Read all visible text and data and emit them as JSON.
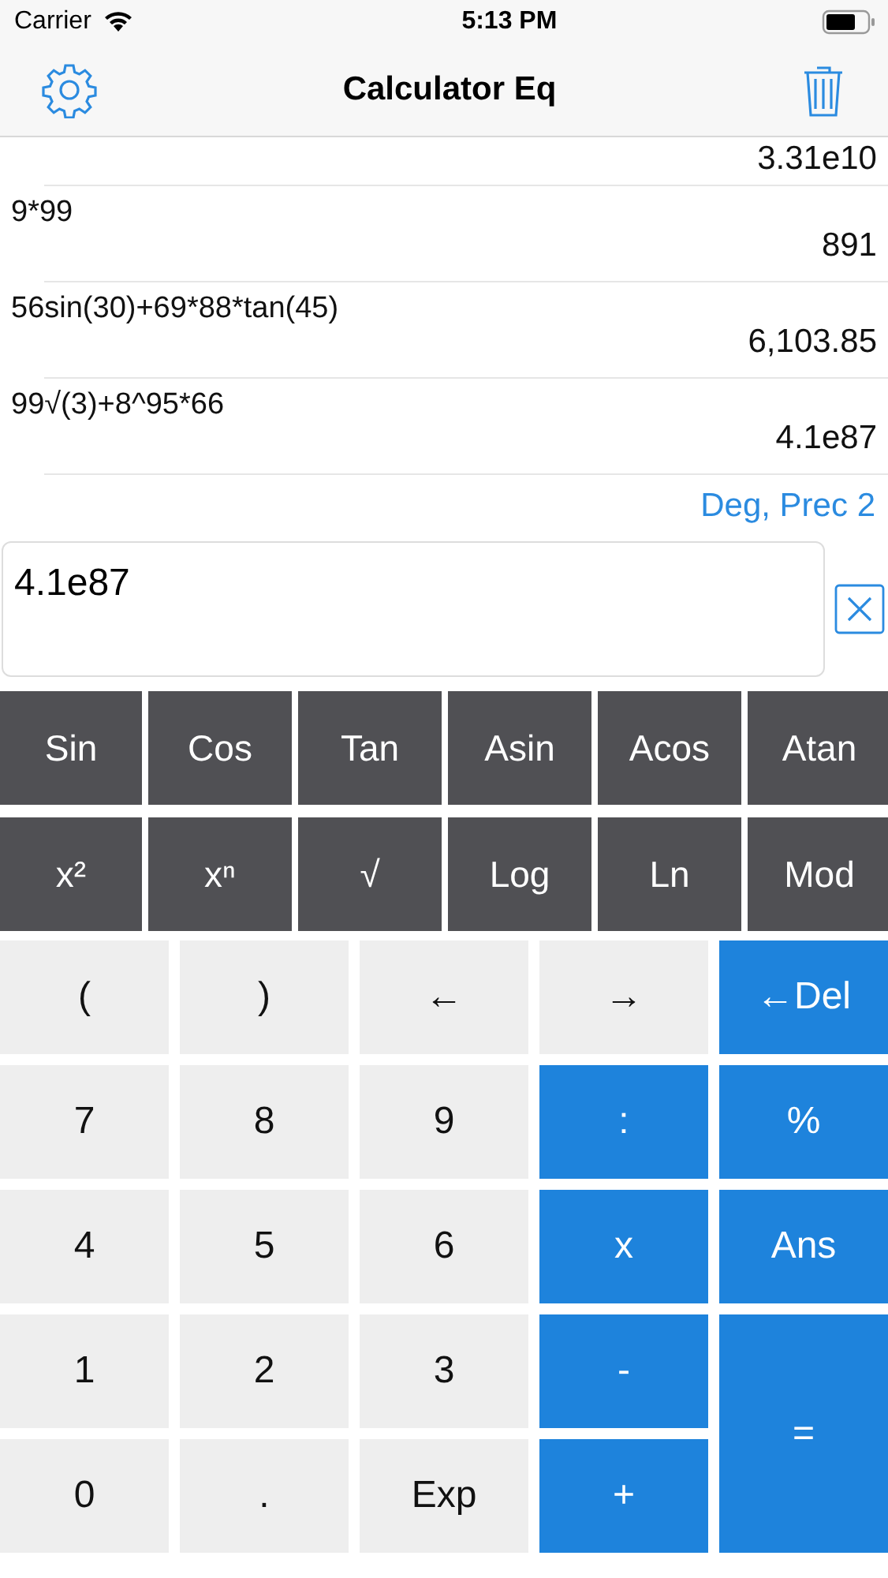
{
  "status_bar": {
    "carrier": "Carrier",
    "time": "5:13 PM"
  },
  "nav": {
    "title": "Calculator Eq"
  },
  "history": [
    {
      "result": "3.31e10"
    },
    {
      "expression": "9*99",
      "result": "891"
    },
    {
      "expression": "56sin(30)+69*88*tan(45)",
      "result": "6,103.85"
    },
    {
      "expression": "99√(3)+8^95*66",
      "result": "4.1e87"
    }
  ],
  "mode": "Deg, Prec 2",
  "input": {
    "value": "4.1e87"
  },
  "scientific_keys": [
    {
      "label": "Sin"
    },
    {
      "label": "Cos"
    },
    {
      "label": "Tan"
    },
    {
      "label": "Asin"
    },
    {
      "label": "Acos"
    },
    {
      "label": "Atan"
    },
    {
      "label": "x²"
    },
    {
      "label": "xⁿ"
    },
    {
      "label": "√"
    },
    {
      "label": "Log"
    },
    {
      "label": "Ln"
    },
    {
      "label": "Mod"
    }
  ],
  "keypad": [
    {
      "label": "(",
      "kind": "light"
    },
    {
      "label": ")",
      "kind": "light"
    },
    {
      "label": "←",
      "kind": "light"
    },
    {
      "label": "→",
      "kind": "light"
    },
    {
      "label": "←Del",
      "kind": "blue"
    },
    {
      "label": "7",
      "kind": "light"
    },
    {
      "label": "8",
      "kind": "light"
    },
    {
      "label": "9",
      "kind": "light"
    },
    {
      "label": ":",
      "kind": "blue"
    },
    {
      "label": "%",
      "kind": "blue"
    },
    {
      "label": "4",
      "kind": "light"
    },
    {
      "label": "5",
      "kind": "light"
    },
    {
      "label": "6",
      "kind": "light"
    },
    {
      "label": "x",
      "kind": "blue"
    },
    {
      "label": "Ans",
      "kind": "blue"
    },
    {
      "label": "1",
      "kind": "light"
    },
    {
      "label": "2",
      "kind": "light"
    },
    {
      "label": "3",
      "kind": "light"
    },
    {
      "label": "-",
      "kind": "blue"
    },
    {
      "label": "=",
      "kind": "blue-tall"
    },
    {
      "label": "0",
      "kind": "light"
    },
    {
      "label": ".",
      "kind": "light"
    },
    {
      "label": "Exp",
      "kind": "light"
    },
    {
      "label": "+",
      "kind": "blue"
    }
  ]
}
